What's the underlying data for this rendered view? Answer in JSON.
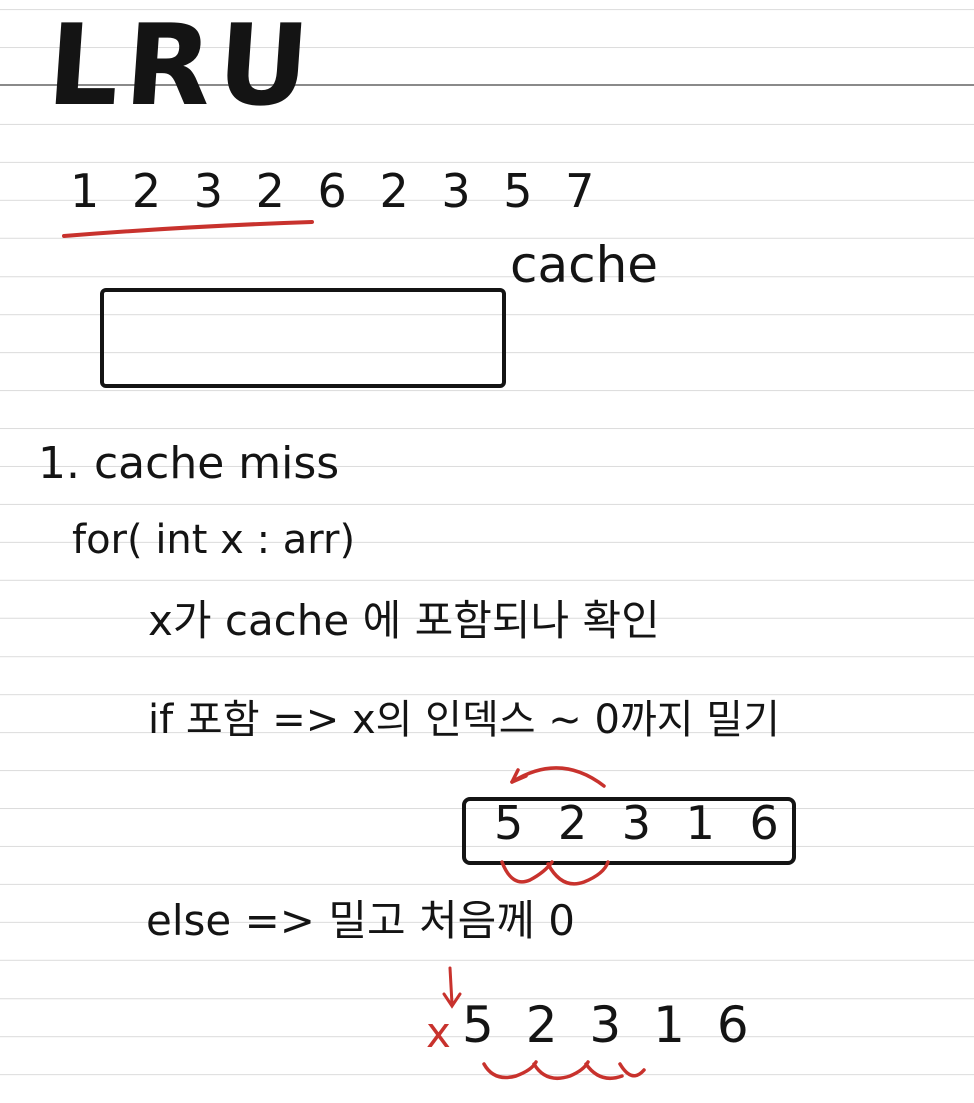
{
  "title": "LRU",
  "sequence": "1 2 3 2 6 2 3 5 7",
  "cache_label": "cache",
  "step1": "1. cache miss",
  "for_loop": "for( int x : arr)",
  "check_line": "x가 cache 에 포함되나 확인",
  "if_line": "if 포함 => x의 인덱스 ~ 0까지 밀기",
  "array_example_1": "5 2 3 1 6",
  "else_line": "else => 밀고 처음께 0",
  "x_mark": "x",
  "array_example_2": "5 2 3 1 6",
  "colors": {
    "ink": "#141414",
    "red": "#c8322d",
    "rule": "#dcdcdc"
  }
}
